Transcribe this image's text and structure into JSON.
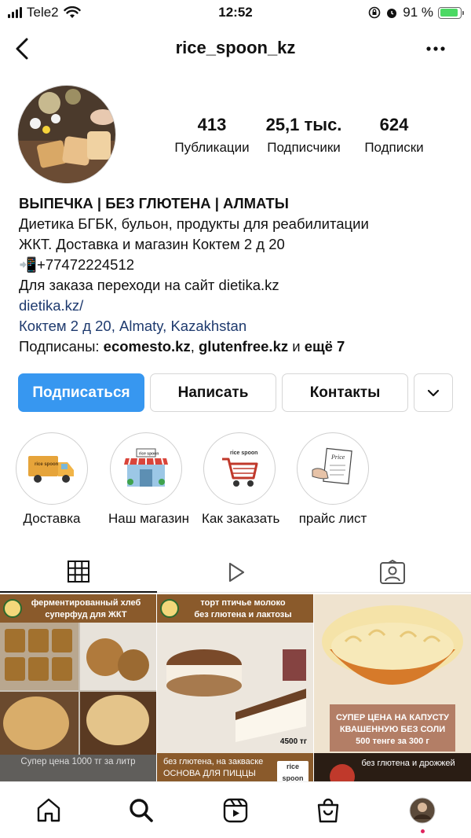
{
  "status_bar": {
    "carrier": "Tele2",
    "time": "12:52",
    "battery_percent": "91 %",
    "battery_level": 0.91
  },
  "header": {
    "username": "rice_spoon_kz"
  },
  "stats": {
    "posts_count": "413",
    "posts_label": "Публикации",
    "followers_count": "25,1 тыс.",
    "followers_label": "Подписчики",
    "following_count": "624",
    "following_label": "Подписки"
  },
  "bio": {
    "name": "ВЫПЕЧКА | БЕЗ ГЛЮТЕНА | АЛМАТЫ",
    "line1": "Диетика БГБК, бульон, продукты для реабилитации",
    "line2": "ЖКТ. Доставка и магазин Коктем 2 д 20",
    "phone": "📲+77472224512",
    "line4": "Для заказа переходи на сайт dietika.kz",
    "website": "dietika.kz/",
    "location": "Коктем 2 д 20, Almaty, Kazakhstan",
    "followed_by_prefix": "Подписаны: ",
    "followed_by_1": "ecomesto.kz",
    "followed_by_sep": ", ",
    "followed_by_2": "glutenfree.kz",
    "followed_by_and": " и ",
    "followed_by_more": "ещё 7"
  },
  "actions": {
    "follow_label": "Подписаться",
    "message_label": "Написать",
    "contacts_label": "Контакты"
  },
  "highlights": [
    {
      "label": "Доставка",
      "icon": "delivery-truck-icon",
      "badge": "rice spoon"
    },
    {
      "label": "Наш магазин",
      "icon": "store-front-icon",
      "badge": "rice spoon"
    },
    {
      "label": "Как заказать",
      "icon": "shopping-cart-icon",
      "badge": "rice spoon"
    },
    {
      "label": "прайс лист",
      "icon": "price-list-icon",
      "badge": "Price"
    }
  ],
  "tabs": [
    {
      "name": "posts-grid",
      "icon": "grid-icon",
      "active": true
    },
    {
      "name": "reels",
      "icon": "play-icon",
      "active": false
    },
    {
      "name": "tagged",
      "icon": "tagged-icon",
      "active": false
    }
  ],
  "posts": [
    {
      "top_caption_1": "ферментированный хлеб",
      "top_caption_2": "суперфуд для ЖКТ",
      "bottom_caption": "Супер цена 1000 тг за литр"
    },
    {
      "top_caption_1": "торт птичье молоко",
      "top_caption_2": "без глютена и лактозы",
      "price": "4500 тг",
      "bottom_caption_1": "без глютена, на закваске",
      "bottom_caption_2": "ОСНОВА ДЛЯ ПИЦЦЫ",
      "brand": "rice spoon"
    },
    {
      "overlay_1": "СУПЕР ЦЕНА НА КАПУСТУ",
      "overlay_2": "КВАШЕННУЮ БЕЗ СОЛИ",
      "overlay_3": "500 тенге за 300 г",
      "bottom_caption": "без глютена и дрожжей"
    }
  ],
  "colors": {
    "primary_button": "#3797f0",
    "link": "#1e3a6e",
    "battery_green": "#4cd964",
    "notification_dot": "#e0245e"
  }
}
